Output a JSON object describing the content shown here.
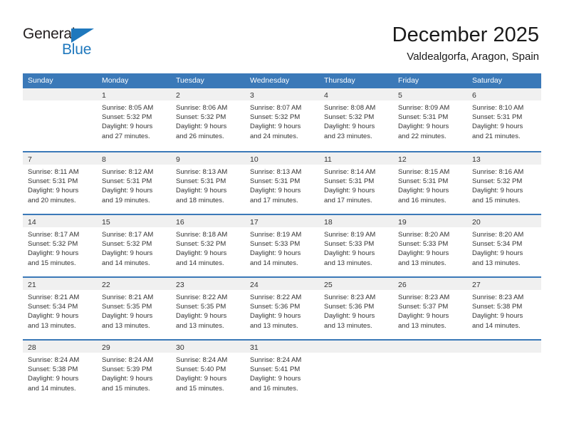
{
  "brand": {
    "name_top": "General",
    "name_bottom": "Blue",
    "triangle_icon": "triangle-icon",
    "accent_color": "#1f78bd"
  },
  "header": {
    "title": "December 2025",
    "subtitle": "Valdealgorfa, Aragon, Spain"
  },
  "calendar": {
    "header_color": "#3b79b8",
    "weekdays": [
      "Sunday",
      "Monday",
      "Tuesday",
      "Wednesday",
      "Thursday",
      "Friday",
      "Saturday"
    ],
    "weeks": [
      [
        {
          "day": "",
          "lines": []
        },
        {
          "day": "1",
          "lines": [
            "Sunrise: 8:05 AM",
            "Sunset: 5:32 PM",
            "Daylight: 9 hours",
            "and 27 minutes."
          ]
        },
        {
          "day": "2",
          "lines": [
            "Sunrise: 8:06 AM",
            "Sunset: 5:32 PM",
            "Daylight: 9 hours",
            "and 26 minutes."
          ]
        },
        {
          "day": "3",
          "lines": [
            "Sunrise: 8:07 AM",
            "Sunset: 5:32 PM",
            "Daylight: 9 hours",
            "and 24 minutes."
          ]
        },
        {
          "day": "4",
          "lines": [
            "Sunrise: 8:08 AM",
            "Sunset: 5:32 PM",
            "Daylight: 9 hours",
            "and 23 minutes."
          ]
        },
        {
          "day": "5",
          "lines": [
            "Sunrise: 8:09 AM",
            "Sunset: 5:31 PM",
            "Daylight: 9 hours",
            "and 22 minutes."
          ]
        },
        {
          "day": "6",
          "lines": [
            "Sunrise: 8:10 AM",
            "Sunset: 5:31 PM",
            "Daylight: 9 hours",
            "and 21 minutes."
          ]
        }
      ],
      [
        {
          "day": "7",
          "lines": [
            "Sunrise: 8:11 AM",
            "Sunset: 5:31 PM",
            "Daylight: 9 hours",
            "and 20 minutes."
          ]
        },
        {
          "day": "8",
          "lines": [
            "Sunrise: 8:12 AM",
            "Sunset: 5:31 PM",
            "Daylight: 9 hours",
            "and 19 minutes."
          ]
        },
        {
          "day": "9",
          "lines": [
            "Sunrise: 8:13 AM",
            "Sunset: 5:31 PM",
            "Daylight: 9 hours",
            "and 18 minutes."
          ]
        },
        {
          "day": "10",
          "lines": [
            "Sunrise: 8:13 AM",
            "Sunset: 5:31 PM",
            "Daylight: 9 hours",
            "and 17 minutes."
          ]
        },
        {
          "day": "11",
          "lines": [
            "Sunrise: 8:14 AM",
            "Sunset: 5:31 PM",
            "Daylight: 9 hours",
            "and 17 minutes."
          ]
        },
        {
          "day": "12",
          "lines": [
            "Sunrise: 8:15 AM",
            "Sunset: 5:31 PM",
            "Daylight: 9 hours",
            "and 16 minutes."
          ]
        },
        {
          "day": "13",
          "lines": [
            "Sunrise: 8:16 AM",
            "Sunset: 5:32 PM",
            "Daylight: 9 hours",
            "and 15 minutes."
          ]
        }
      ],
      [
        {
          "day": "14",
          "lines": [
            "Sunrise: 8:17 AM",
            "Sunset: 5:32 PM",
            "Daylight: 9 hours",
            "and 15 minutes."
          ]
        },
        {
          "day": "15",
          "lines": [
            "Sunrise: 8:17 AM",
            "Sunset: 5:32 PM",
            "Daylight: 9 hours",
            "and 14 minutes."
          ]
        },
        {
          "day": "16",
          "lines": [
            "Sunrise: 8:18 AM",
            "Sunset: 5:32 PM",
            "Daylight: 9 hours",
            "and 14 minutes."
          ]
        },
        {
          "day": "17",
          "lines": [
            "Sunrise: 8:19 AM",
            "Sunset: 5:33 PM",
            "Daylight: 9 hours",
            "and 14 minutes."
          ]
        },
        {
          "day": "18",
          "lines": [
            "Sunrise: 8:19 AM",
            "Sunset: 5:33 PM",
            "Daylight: 9 hours",
            "and 13 minutes."
          ]
        },
        {
          "day": "19",
          "lines": [
            "Sunrise: 8:20 AM",
            "Sunset: 5:33 PM",
            "Daylight: 9 hours",
            "and 13 minutes."
          ]
        },
        {
          "day": "20",
          "lines": [
            "Sunrise: 8:20 AM",
            "Sunset: 5:34 PM",
            "Daylight: 9 hours",
            "and 13 minutes."
          ]
        }
      ],
      [
        {
          "day": "21",
          "lines": [
            "Sunrise: 8:21 AM",
            "Sunset: 5:34 PM",
            "Daylight: 9 hours",
            "and 13 minutes."
          ]
        },
        {
          "day": "22",
          "lines": [
            "Sunrise: 8:21 AM",
            "Sunset: 5:35 PM",
            "Daylight: 9 hours",
            "and 13 minutes."
          ]
        },
        {
          "day": "23",
          "lines": [
            "Sunrise: 8:22 AM",
            "Sunset: 5:35 PM",
            "Daylight: 9 hours",
            "and 13 minutes."
          ]
        },
        {
          "day": "24",
          "lines": [
            "Sunrise: 8:22 AM",
            "Sunset: 5:36 PM",
            "Daylight: 9 hours",
            "and 13 minutes."
          ]
        },
        {
          "day": "25",
          "lines": [
            "Sunrise: 8:23 AM",
            "Sunset: 5:36 PM",
            "Daylight: 9 hours",
            "and 13 minutes."
          ]
        },
        {
          "day": "26",
          "lines": [
            "Sunrise: 8:23 AM",
            "Sunset: 5:37 PM",
            "Daylight: 9 hours",
            "and 13 minutes."
          ]
        },
        {
          "day": "27",
          "lines": [
            "Sunrise: 8:23 AM",
            "Sunset: 5:38 PM",
            "Daylight: 9 hours",
            "and 14 minutes."
          ]
        }
      ],
      [
        {
          "day": "28",
          "lines": [
            "Sunrise: 8:24 AM",
            "Sunset: 5:38 PM",
            "Daylight: 9 hours",
            "and 14 minutes."
          ]
        },
        {
          "day": "29",
          "lines": [
            "Sunrise: 8:24 AM",
            "Sunset: 5:39 PM",
            "Daylight: 9 hours",
            "and 15 minutes."
          ]
        },
        {
          "day": "30",
          "lines": [
            "Sunrise: 8:24 AM",
            "Sunset: 5:40 PM",
            "Daylight: 9 hours",
            "and 15 minutes."
          ]
        },
        {
          "day": "31",
          "lines": [
            "Sunrise: 8:24 AM",
            "Sunset: 5:41 PM",
            "Daylight: 9 hours",
            "and 16 minutes."
          ]
        },
        {
          "day": "",
          "lines": []
        },
        {
          "day": "",
          "lines": []
        },
        {
          "day": "",
          "lines": []
        }
      ]
    ]
  }
}
